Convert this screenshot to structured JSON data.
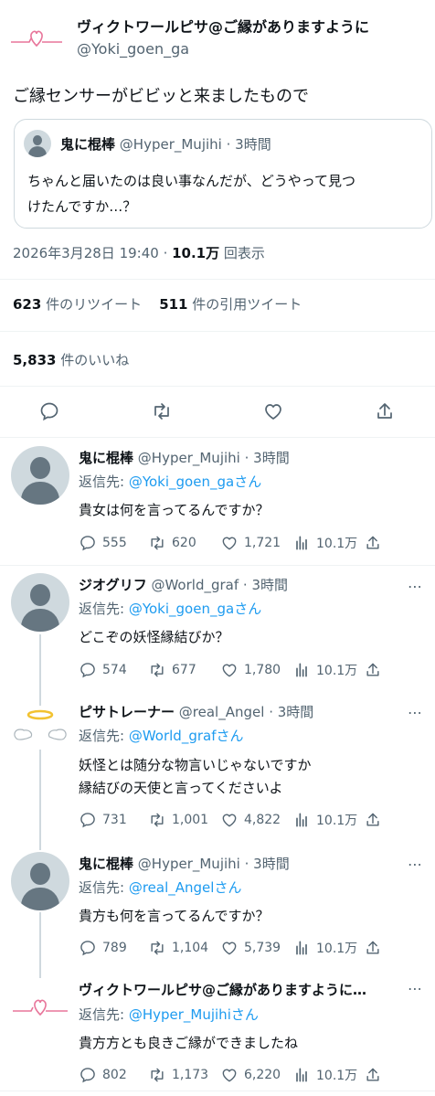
{
  "main_tweet": {
    "author_name": "ヴィクトワールピサ@ご縁がありますように",
    "handle": "@Yoki_goen_ga",
    "text": "ご縁センサーがビビッと来ましたもので",
    "quote": {
      "author_name": "鬼に棍棒",
      "handle": "@Hyper_Mujihi",
      "time": "· 3時間",
      "text_line1": "ちゃんと届いたのは良い事なんだが、どうやって見つ",
      "text_line2": "けたんですか…？"
    },
    "timestamp": "2026年3月28日 19:40 · ",
    "views_count": "10.1万",
    "views_label": "回表示",
    "retweets_count": "623",
    "retweets_label": "件のリツイート",
    "quotes_count": "511",
    "quotes_label": "件の引用ツイート",
    "likes_count": "5,833",
    "likes_label": "件のいいね"
  },
  "replies": [
    {
      "name": "鬼に棍棒",
      "handle": "@Hyper_Mujihi",
      "time": "· 3時間",
      "reply_prefix": "返信先: ",
      "reply_to": "@Yoki_goen_ga",
      "reply_suffix": "さん",
      "text_lines": [
        "貴女は何を言ってるんですか？"
      ],
      "stats": {
        "replies": "555",
        "retweets": "620",
        "likes": "1,721",
        "views": "10.1万"
      }
    },
    {
      "name": "ジオグリフ",
      "handle": "@World_graf",
      "time": "· 3時間",
      "reply_prefix": "返信先: ",
      "reply_to": "@Yoki_goen_ga",
      "reply_suffix": "さん",
      "text_lines": [
        "どこぞの妖怪縁結びか？"
      ],
      "stats": {
        "replies": "574",
        "retweets": "677",
        "likes": "1,780",
        "views": "10.1万"
      }
    },
    {
      "name": "ピサトレーナー",
      "handle": "@real_Angel",
      "time": "· 3時間",
      "reply_prefix": "返信先: ",
      "reply_to": "@World_graf",
      "reply_suffix": "さん",
      "text_lines": [
        "妖怪とは随分な物言いじゃないですか",
        "縁結びの天使と言ってくださいよ"
      ],
      "stats": {
        "replies": "731",
        "retweets": "1,001",
        "likes": "4,822",
        "views": "10.1万"
      }
    },
    {
      "name": "鬼に棍棒",
      "handle": "@Hyper_Mujihi",
      "time": "· 3時間",
      "reply_prefix": "返信先: ",
      "reply_to": "@real_Angel",
      "reply_suffix": "さん",
      "text_lines": [
        "貴方も何を言ってるんですか？"
      ],
      "stats": {
        "replies": "789",
        "retweets": "1,104",
        "likes": "5,739",
        "views": "10.1万"
      }
    },
    {
      "name": "ヴィクトワールピサ@ご縁がありますように…",
      "handle": "",
      "time": "",
      "reply_prefix": "返信先: ",
      "reply_to": "@Hyper_Mujihi",
      "reply_suffix": "さん",
      "text_lines": [
        "貴方方とも良きご縁ができましたね"
      ],
      "stats": {
        "replies": "802",
        "retweets": "1,173",
        "likes": "6,220",
        "views": "10.1万"
      }
    }
  ],
  "colors": {
    "accent": "#1d9bf0",
    "secondary_text": "#536471",
    "divider": "#eff3f4",
    "heart_pink": "#e8759a",
    "halo_gold": "#f2c230"
  }
}
